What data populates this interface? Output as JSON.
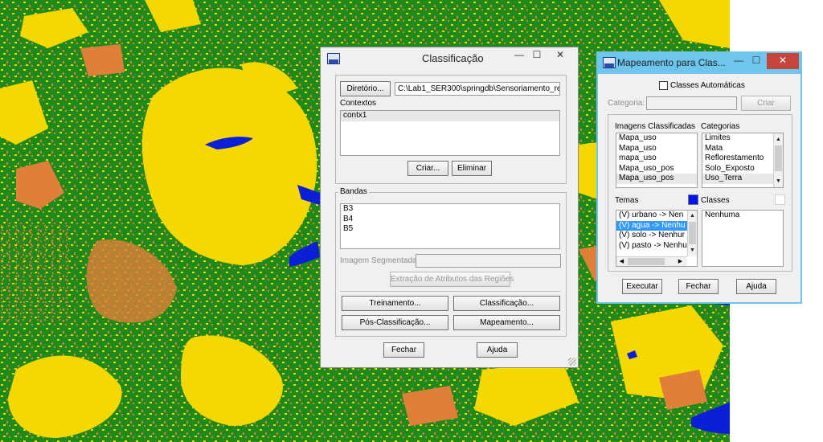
{
  "colors": {
    "map_vegetation": "#1f8a1c",
    "map_bare_soil": "#f4d800",
    "map_urban": "#e07f39",
    "map_water": "#0a1fd6",
    "selection": "#3399ff",
    "mapeamento_frame": "#6fc6ec",
    "classes_swatch_blue": "#0014f0",
    "classes_swatch_white": "#ffffff"
  },
  "classificacao": {
    "title": "Classificação",
    "diretorio_button": "Diretório...",
    "diretorio_path": "C:\\Lab1_SER300\\springdb\\Sensoriamento_remoto",
    "contextos_label": "Contextos",
    "contextos": [
      "contx1"
    ],
    "criar_button": "Criar...",
    "eliminar_button": "Eliminar",
    "bandas_label": "Bandas",
    "bandas": [
      "B3",
      "B4",
      "B5"
    ],
    "imagem_segmentada_label": "Imagem Segmentada:",
    "extracao_button": "Extração de Atributos das Regiões",
    "treinamento_button": "Treinamento...",
    "classificacao_button": "Classificação...",
    "pos_classificacao_button": "Pós-Classificação...",
    "mapeamento_button": "Mapeamento...",
    "fechar_button": "Fechar",
    "ajuda_button": "Ajuda"
  },
  "mapeamento": {
    "title": "Mapeamento para Clas...",
    "classes_automaticas_label": "Classes Automáticas",
    "classes_automaticas_checked": false,
    "categoria_label": "Categoria:",
    "criar_button": "Criar",
    "imagens_label": "Imagens Classificadas",
    "imagens": [
      "Mapa_uso",
      "Mapa_uso",
      "mapa_uso",
      "Mapa_uso_pos",
      "Mapa_uso_pos"
    ],
    "categorias_label": "Categorias",
    "categorias": [
      "Limites",
      "Mata",
      "Reflorestamento",
      "Solo_Exposto",
      "Uso_Terra"
    ],
    "temas_label": "Temas",
    "classes_label": "Classes",
    "temas": [
      "(V) urbano -> Nen",
      "(V) agua -> Nenhu",
      "(V) solo -> Nenhur",
      "(V) pasto -> Nenhu"
    ],
    "temas_selected_index": 1,
    "classes": [
      "Nenhuma"
    ],
    "executar_button": "Executar",
    "fechar_button": "Fechar",
    "ajuda_button": "Ajuda"
  },
  "title_buttons": {
    "minimize": "—",
    "maximize": "☐",
    "close": "✕"
  }
}
